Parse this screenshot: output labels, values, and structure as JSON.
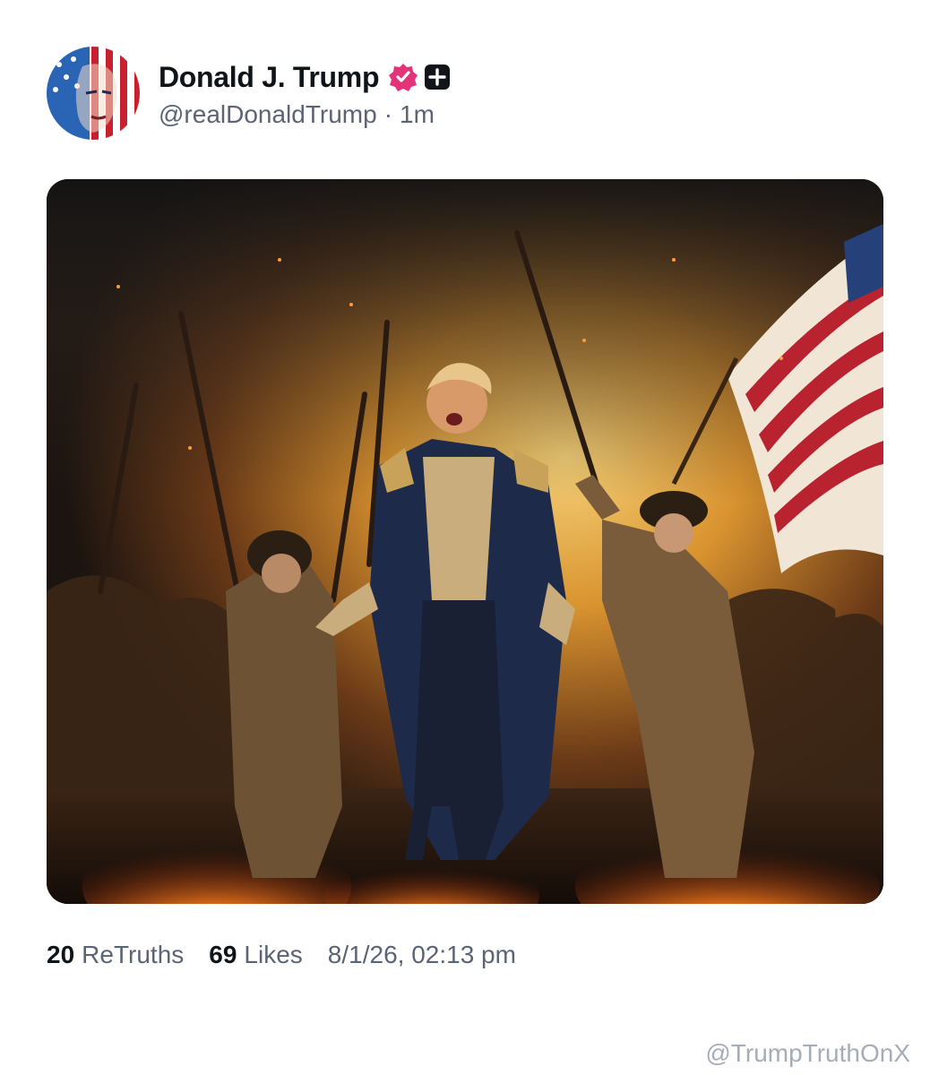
{
  "post": {
    "display_name": "Donald J. Trump",
    "handle": "@realDonaldTrump",
    "separator": "·",
    "time_ago": "1m",
    "verified_icon": "verified-badge-icon",
    "plus_icon": "plus-badge-icon",
    "accent_color": "#e5337a",
    "image_description_icon": "post-image"
  },
  "stats": {
    "retruths_count": "20",
    "retruths_label": "ReTruths",
    "likes_count": "69",
    "likes_label": "Likes",
    "timestamp": "8/1/26, 02:13 pm"
  },
  "watermark": {
    "text": "@TrumpTruthOnX"
  }
}
